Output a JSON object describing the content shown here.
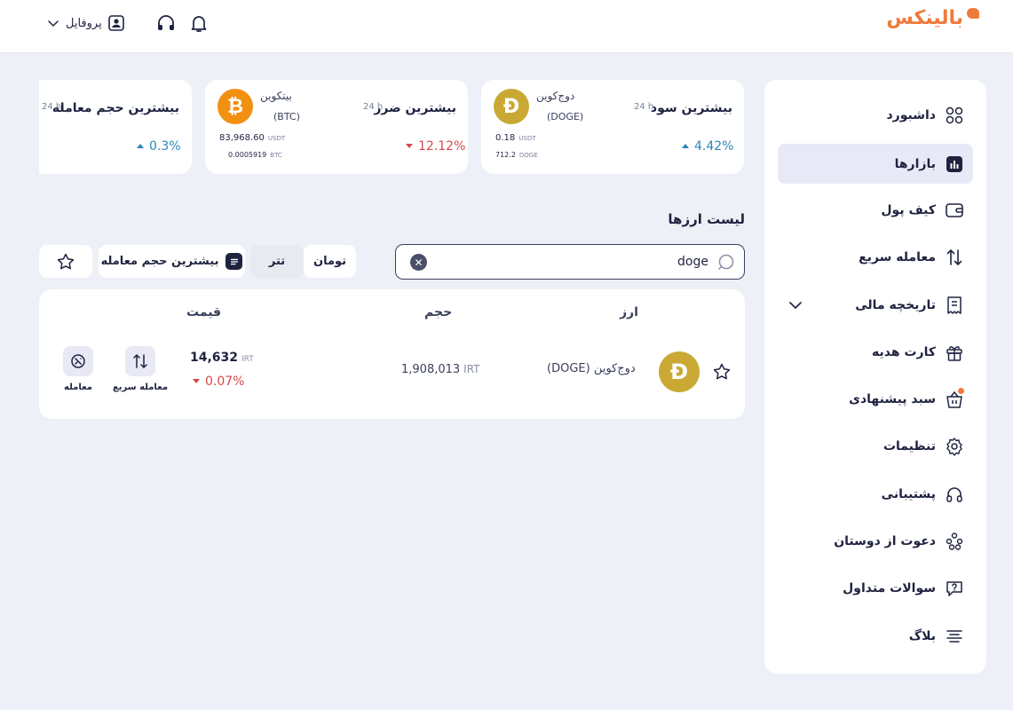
{
  "header": {
    "logo": "بالینکس",
    "profile_label": "پروفایل"
  },
  "sidebar": {
    "items": [
      {
        "label": "داشبورد",
        "icon": "grid-icon"
      },
      {
        "label": "بازارها",
        "icon": "chart-icon",
        "active": true
      },
      {
        "label": "کیف پول",
        "icon": "wallet-icon"
      },
      {
        "label": "معامله سریع",
        "icon": "swap-icon"
      },
      {
        "label": "تاریخچه مالی",
        "icon": "receipt-icon",
        "expandable": true
      },
      {
        "label": "کارت هدیه",
        "icon": "gift-icon"
      },
      {
        "label": "سبد پیشنهادی",
        "icon": "basket-icon",
        "badge": true
      },
      {
        "label": "تنظیمات",
        "icon": "settings-icon"
      },
      {
        "label": "پشتیبانی",
        "icon": "headset-icon"
      },
      {
        "label": "دعوت از دوستان",
        "icon": "invite-icon"
      },
      {
        "label": "سوالات متداول",
        "icon": "faq-icon"
      },
      {
        "label": "بلاگ",
        "icon": "blog-icon"
      }
    ]
  },
  "cards": {
    "gain": {
      "title": "بیشترین سود",
      "period": "24 h",
      "coin_name": "دوج‌کوین",
      "coin_symbol": "(DOGE)",
      "val1": "0.18",
      "val1_unit": "USDT",
      "val2": "712.2",
      "val2_unit": "DOGE",
      "change": "4.42%"
    },
    "loss": {
      "title": "بیشترین ضرر",
      "period": "24 h",
      "coin_name": "بیتکوین",
      "coin_symbol": "(BTC)",
      "val1": "83,968.60",
      "val1_unit": "USDT",
      "val2": "0.0005919",
      "val2_unit": "BTC",
      "change": "12.12%"
    },
    "volume": {
      "title": "بیشترین حجم معامله",
      "period": "24 h",
      "change": "0.3%"
    }
  },
  "list": {
    "title": "لیست ارزها",
    "search_value": "doge",
    "filters": {
      "toman": "تومان",
      "tether": "تتر",
      "sort": "بیشترین حجم معامله"
    },
    "columns": {
      "currency": "ارز",
      "volume": "حجم",
      "price": "قیمت"
    },
    "rows": [
      {
        "name": "دوج‌کوین",
        "symbol": "(DOGE)",
        "volume": "1,908,013",
        "volume_unit": "IRT",
        "price": "14,632",
        "price_unit": "IRT",
        "change": "0.07%",
        "action_quick": "معامله سریع",
        "action_trade": "معامله"
      }
    ]
  },
  "colors": {
    "brand": "#f07a3a",
    "up": "#2b86b8",
    "down": "#d64848",
    "dark": "#1f2340"
  }
}
